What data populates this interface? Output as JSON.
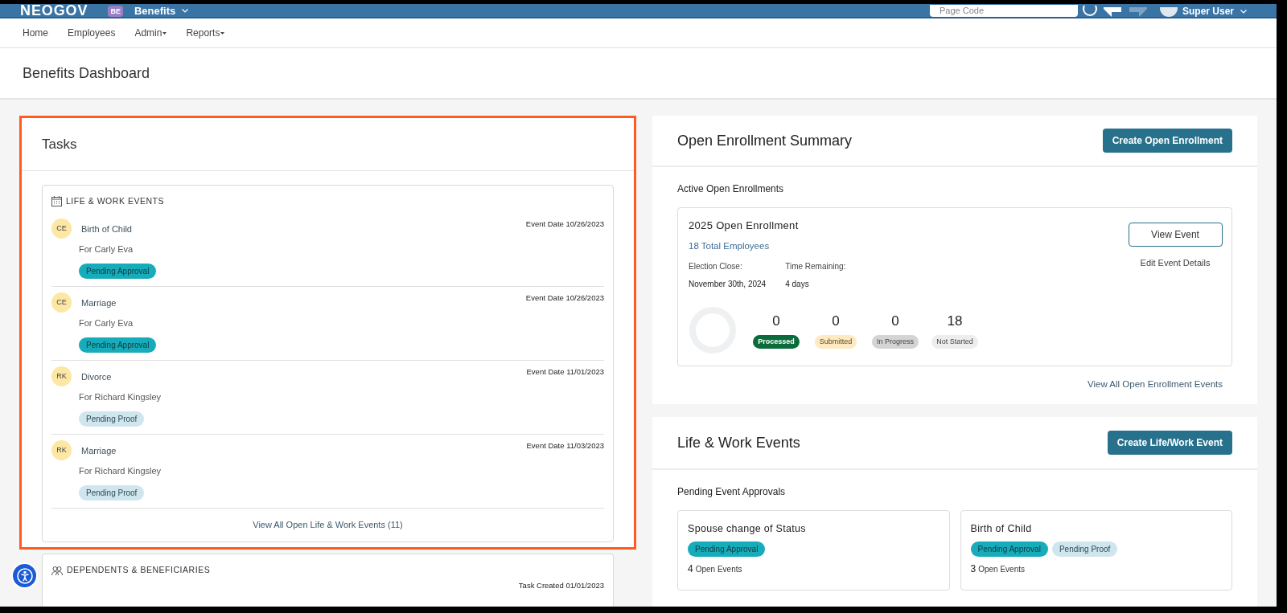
{
  "header": {
    "logo": "NEOGOV",
    "app_badge": "BE",
    "app_name": "Benefits",
    "page_code_placeholder": "Page Code",
    "user": "Super User"
  },
  "nav": [
    {
      "label": "Home",
      "dropdown": false
    },
    {
      "label": "Employees",
      "dropdown": false
    },
    {
      "label": "Admin",
      "dropdown": true
    },
    {
      "label": "Reports",
      "dropdown": true
    }
  ],
  "page_title": "Benefits Dashboard",
  "tasks": {
    "title": "Tasks",
    "highlighted": true,
    "life_work": {
      "heading": "LIFE & WORK EVENTS",
      "events": [
        {
          "initials": "CE",
          "name": "Birth of Child",
          "for": "For Carly Eva",
          "date": "Event Date 10/26/2023",
          "status": {
            "label": "Pending Approval",
            "kind": "approval"
          }
        },
        {
          "initials": "CE",
          "name": "Marriage",
          "for": "For Carly Eva",
          "date": "Event Date 10/26/2023",
          "status": {
            "label": "Pending Approval",
            "kind": "approval"
          }
        },
        {
          "initials": "RK",
          "name": "Divorce",
          "for": "For Richard Kingsley",
          "date": "Event Date 11/01/2023",
          "status": {
            "label": "Pending Proof",
            "kind": "proof"
          }
        },
        {
          "initials": "RK",
          "name": "Marriage",
          "for": "For Richard Kingsley",
          "date": "Event Date 11/03/2023",
          "status": {
            "label": "Pending Proof",
            "kind": "proof"
          }
        }
      ],
      "view_all": "View All Open Life & Work Events (11)"
    },
    "dependents": {
      "heading": "DEPENDENTS & BENEFICIARIES",
      "task_created": "Task Created 01/01/2023"
    }
  },
  "open_enrollment": {
    "title": "Open Enrollment Summary",
    "create_button": "Create Open Enrollment",
    "section_label": "Active Open Enrollments",
    "event": {
      "title": "2025 Open Enrollment",
      "employees": "18 Total Employees",
      "election_close_label": "Election Close:",
      "election_close": "November 30th, 2024",
      "time_remaining_label": "Time Remaining:",
      "time_remaining": "4 days",
      "view_button": "View Event",
      "edit_link": "Edit Event Details",
      "stats": [
        {
          "value": "0",
          "label": "Processed",
          "kind": "processed"
        },
        {
          "value": "0",
          "label": "Submitted",
          "kind": "submitted"
        },
        {
          "value": "0",
          "label": "In Progress",
          "kind": "in_progress"
        },
        {
          "value": "18",
          "label": "Not Started",
          "kind": "not_started"
        }
      ]
    },
    "view_all": "View All Open Enrollment Events"
  },
  "life_work": {
    "title": "Life & Work Events",
    "create_button": "Create Life/Work Event",
    "section_label": "Pending Event Approvals",
    "approvals": [
      {
        "title": "Spouse change of Status",
        "statuses": [
          {
            "label": "Pending Approval",
            "kind": "approval"
          }
        ],
        "count": "4",
        "count_label": "Open Events"
      },
      {
        "title": "Birth of Child",
        "statuses": [
          {
            "label": "Pending Approval",
            "kind": "approval"
          },
          {
            "label": "Pending Proof",
            "kind": "proof"
          }
        ],
        "count": "3",
        "count_label": "Open Events"
      }
    ]
  }
}
